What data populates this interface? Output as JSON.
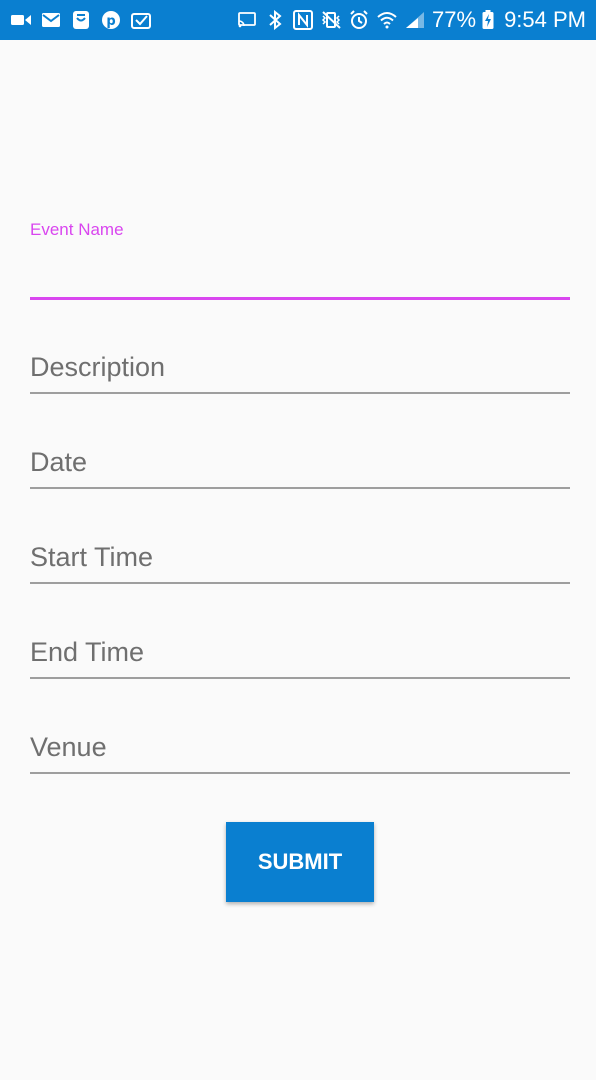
{
  "status_bar": {
    "left_icons": [
      "video-camera-icon",
      "gmail-icon",
      "messenger-icon",
      "pinterest-icon",
      "inbox-icon"
    ],
    "right_icons": [
      "cast-icon",
      "bluetooth-icon",
      "nfc-icon",
      "vibrate-mute-icon",
      "alarm-icon",
      "wifi-icon",
      "signal-icon",
      "battery-charging-icon"
    ],
    "battery_percent": "77%",
    "time": "9:54 PM",
    "background_color": "#0a7fd0"
  },
  "form": {
    "event_name": {
      "label": "Event Name",
      "value": "",
      "focused": true
    },
    "description": {
      "placeholder": "Description",
      "value": ""
    },
    "date": {
      "placeholder": "Date",
      "value": ""
    },
    "start_time": {
      "placeholder": "Start Time",
      "value": ""
    },
    "end_time": {
      "placeholder": "End Time",
      "value": ""
    },
    "venue": {
      "placeholder": "Venue",
      "value": ""
    },
    "accent_color": "#d946ef"
  },
  "submit_button": {
    "label": "SUBMIT",
    "color": "#0a7fd0"
  }
}
